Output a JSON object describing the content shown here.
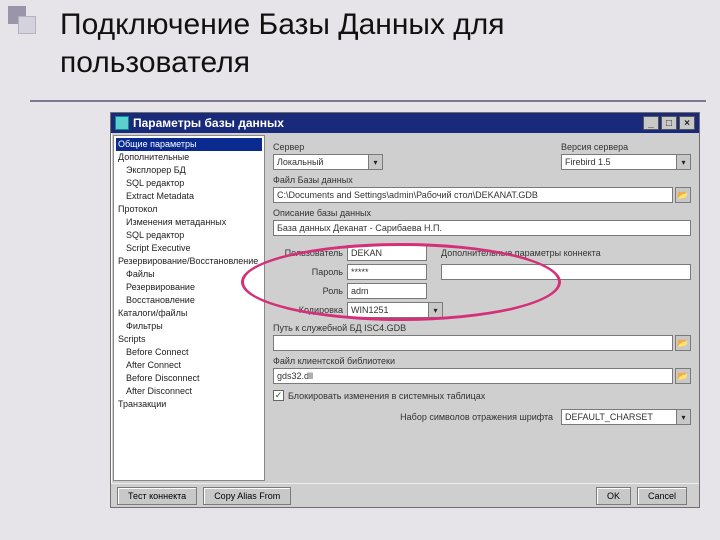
{
  "slide": {
    "title": "Подключение Базы Данных для пользователя"
  },
  "window": {
    "title": "Параметры базы данных",
    "min": "_",
    "max": "□",
    "close": "×"
  },
  "tree": {
    "sel": "Общие параметры",
    "items": [
      {
        "t": "Дополнительные",
        "l": 0
      },
      {
        "t": "Эксплорер БД",
        "l": 1
      },
      {
        "t": "SQL редактор",
        "l": 1
      },
      {
        "t": "Extract Metadata",
        "l": 1
      },
      {
        "t": "Протокол",
        "l": 0
      },
      {
        "t": "Изменения метаданных",
        "l": 1
      },
      {
        "t": "SQL редактор",
        "l": 1
      },
      {
        "t": "Script Executive",
        "l": 1
      },
      {
        "t": "Резервирование/Восстановление",
        "l": 0
      },
      {
        "t": "Файлы",
        "l": 1
      },
      {
        "t": "Резервирование",
        "l": 1
      },
      {
        "t": "Восстановление",
        "l": 1
      },
      {
        "t": "Каталоги/файлы",
        "l": 0
      },
      {
        "t": "Фильтры",
        "l": 1
      },
      {
        "t": "Scripts",
        "l": 0
      },
      {
        "t": "Before Connect",
        "l": 1
      },
      {
        "t": "After Connect",
        "l": 1
      },
      {
        "t": "Before Disconnect",
        "l": 1
      },
      {
        "t": "After Disconnect",
        "l": 1
      },
      {
        "t": "Транзакции",
        "l": 0
      }
    ]
  },
  "form": {
    "server_label": "Сервер",
    "server_value": "Локальный",
    "version_label": "Версия сервера",
    "version_value": "Firebird 1.5",
    "dbfile_label": "Файл Базы данных",
    "dbfile_value": "C:\\Documents and Settings\\admin\\Рабочий стол\\DEKANAT.GDB",
    "desc_label": "Описание базы данных",
    "desc_value": "База данных Деканат - Сарибаева Н.П.",
    "user_label": "Пользователь",
    "user_value": "DEKAN",
    "extra_label": "Дополнительные параметры коннекта",
    "pass_label": "Пароль",
    "pass_value": "*****",
    "role_label": "Роль",
    "role_value": "adm",
    "charset_label": "Кодировка",
    "charset_value": "WIN1251",
    "udf_label": "Путь к служебной БД ISC4.GDB",
    "clientlib_label": "Файл клиентской библиотеки",
    "clientlib_value": "gds32.dll",
    "checkbox_label": "Блокировать изменения в системных таблицах",
    "font_label": "Набор символов отражения шрифта",
    "font_value": "DEFAULT_CHARSET"
  },
  "buttons": {
    "test": "Тест коннекта",
    "copy": "Copy Alias From",
    "ok": "OK",
    "cancel": "Cancel"
  },
  "glyph": {
    "dd": "▾",
    "folder": "📂",
    "checked": "✓"
  }
}
